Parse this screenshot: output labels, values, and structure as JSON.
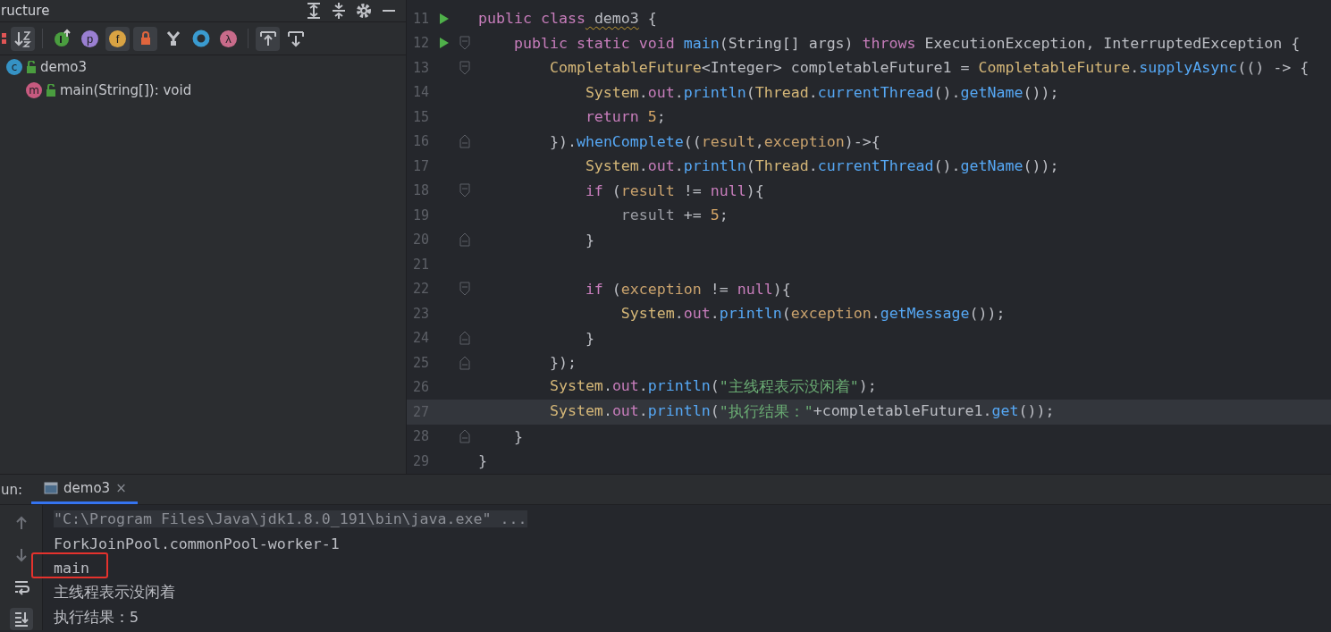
{
  "structure": {
    "title": "ructure",
    "toolbar": [
      {
        "kind": "sort-visibility",
        "selected": false
      },
      {
        "kind": "sort-alpha",
        "selected": true
      },
      {
        "kind": "inherited",
        "selected": false
      },
      {
        "kind": "letter",
        "glyph": "p",
        "color": "#9a7fd1",
        "selected": false
      },
      {
        "kind": "letter",
        "glyph": "f",
        "color": "#d9a343",
        "selected": true
      },
      {
        "kind": "lock",
        "selected": true
      },
      {
        "kind": "fork",
        "selected": false
      },
      {
        "kind": "ring",
        "selected": false
      },
      {
        "kind": "letter",
        "glyph": "λ",
        "color": "#c86b8a",
        "selected": false
      },
      {
        "kind": "autoscroll-to",
        "selected": true
      },
      {
        "kind": "autoscroll-from",
        "selected": false
      }
    ],
    "tree": [
      {
        "label": "demo3",
        "glyph": "c",
        "color": "#3592c4",
        "children": [
          {
            "label": "main(String[]): void",
            "glyph": "m",
            "color": "#c75a7f"
          }
        ]
      }
    ]
  },
  "editor": {
    "lines": [
      {
        "number": "11",
        "run": true,
        "fold_start": false,
        "fold_end": false,
        "current": false,
        "tokens": [
          {
            "text": "public class",
            "kind": "keyword"
          },
          {
            "text": " demo3",
            "kind": "warning"
          },
          {
            "text": " {",
            "kind": "plain"
          }
        ]
      },
      {
        "number": "12",
        "run": true,
        "fold_start": true,
        "fold_end": false,
        "current": false,
        "tokens": [
          {
            "text": "    public static void",
            "kind": "keyword"
          },
          {
            "text": " main",
            "kind": "method"
          },
          {
            "text": "(String[] args) ",
            "kind": "plain"
          },
          {
            "text": "throws",
            "kind": "keyword"
          },
          {
            "text": " ExecutionException, InterruptedException {",
            "kind": "plain"
          }
        ]
      },
      {
        "number": "13",
        "run": false,
        "fold_start": true,
        "fold_end": false,
        "current": false,
        "tokens": [
          {
            "text": "        CompletableFuture",
            "kind": "type"
          },
          {
            "text": "<Integer> completableFuture1 = ",
            "kind": "plain"
          },
          {
            "text": "CompletableFuture",
            "kind": "type"
          },
          {
            "text": ".",
            "kind": "plain"
          },
          {
            "text": "supplyAsync",
            "kind": "method"
          },
          {
            "text": "(() -> {",
            "kind": "plain"
          }
        ]
      },
      {
        "number": "14",
        "run": false,
        "fold_start": false,
        "fold_end": false,
        "current": false,
        "tokens": [
          {
            "text": "            System",
            "kind": "type"
          },
          {
            "text": ".",
            "kind": "plain"
          },
          {
            "text": "out",
            "kind": "field"
          },
          {
            "text": ".",
            "kind": "plain"
          },
          {
            "text": "println",
            "kind": "method"
          },
          {
            "text": "(",
            "kind": "plain"
          },
          {
            "text": "Thread",
            "kind": "type"
          },
          {
            "text": ".",
            "kind": "plain"
          },
          {
            "text": "currentThread",
            "kind": "method"
          },
          {
            "text": "().",
            "kind": "plain"
          },
          {
            "text": "getName",
            "kind": "method"
          },
          {
            "text": "());",
            "kind": "plain"
          }
        ]
      },
      {
        "number": "15",
        "run": false,
        "fold_start": false,
        "fold_end": false,
        "current": false,
        "tokens": [
          {
            "text": "            return",
            "kind": "keyword"
          },
          {
            "text": " 5",
            "kind": "number"
          },
          {
            "text": ";",
            "kind": "plain"
          }
        ]
      },
      {
        "number": "16",
        "run": false,
        "fold_start": false,
        "fold_end": true,
        "current": false,
        "tokens": [
          {
            "text": "        }).",
            "kind": "plain"
          },
          {
            "text": "whenComplete",
            "kind": "method"
          },
          {
            "text": "((",
            "kind": "plain"
          },
          {
            "text": "result",
            "kind": "param"
          },
          {
            "text": ",",
            "kind": "plain"
          },
          {
            "text": "exception",
            "kind": "param"
          },
          {
            "text": ")->{",
            "kind": "plain"
          }
        ]
      },
      {
        "number": "17",
        "run": false,
        "fold_start": false,
        "fold_end": false,
        "current": false,
        "tokens": [
          {
            "text": "            System",
            "kind": "type"
          },
          {
            "text": ".",
            "kind": "plain"
          },
          {
            "text": "out",
            "kind": "field"
          },
          {
            "text": ".",
            "kind": "plain"
          },
          {
            "text": "println",
            "kind": "method"
          },
          {
            "text": "(",
            "kind": "plain"
          },
          {
            "text": "Thread",
            "kind": "type"
          },
          {
            "text": ".",
            "kind": "plain"
          },
          {
            "text": "currentThread",
            "kind": "method"
          },
          {
            "text": "().",
            "kind": "plain"
          },
          {
            "text": "getName",
            "kind": "method"
          },
          {
            "text": "());",
            "kind": "plain"
          }
        ]
      },
      {
        "number": "18",
        "run": false,
        "fold_start": true,
        "fold_end": false,
        "current": false,
        "tokens": [
          {
            "text": "            if",
            "kind": "keyword"
          },
          {
            "text": " (",
            "kind": "plain"
          },
          {
            "text": "result",
            "kind": "param"
          },
          {
            "text": " != ",
            "kind": "plain"
          },
          {
            "text": "null",
            "kind": "keyword"
          },
          {
            "text": "){",
            "kind": "plain"
          }
        ]
      },
      {
        "number": "19",
        "run": false,
        "fold_start": false,
        "fold_end": false,
        "current": false,
        "tokens": [
          {
            "text": "                result",
            "kind": "dim"
          },
          {
            "text": " += ",
            "kind": "plain"
          },
          {
            "text": "5",
            "kind": "number"
          },
          {
            "text": ";",
            "kind": "plain"
          }
        ]
      },
      {
        "number": "20",
        "run": false,
        "fold_start": false,
        "fold_end": true,
        "current": false,
        "tokens": [
          {
            "text": "            }",
            "kind": "plain"
          }
        ]
      },
      {
        "number": "21",
        "run": false,
        "fold_start": false,
        "fold_end": false,
        "current": false
      },
      {
        "number": "22",
        "run": false,
        "fold_start": true,
        "fold_end": false,
        "current": false,
        "tokens": [
          {
            "text": "            if",
            "kind": "keyword"
          },
          {
            "text": " (",
            "kind": "plain"
          },
          {
            "text": "exception",
            "kind": "param"
          },
          {
            "text": " != ",
            "kind": "plain"
          },
          {
            "text": "null",
            "kind": "keyword"
          },
          {
            "text": "){",
            "kind": "plain"
          }
        ]
      },
      {
        "number": "23",
        "run": false,
        "fold_start": false,
        "fold_end": false,
        "current": false,
        "tokens": [
          {
            "text": "                System",
            "kind": "type"
          },
          {
            "text": ".",
            "kind": "plain"
          },
          {
            "text": "out",
            "kind": "field"
          },
          {
            "text": ".",
            "kind": "plain"
          },
          {
            "text": "println",
            "kind": "method"
          },
          {
            "text": "(",
            "kind": "plain"
          },
          {
            "text": "exception",
            "kind": "param"
          },
          {
            "text": ".",
            "kind": "plain"
          },
          {
            "text": "getMessage",
            "kind": "method"
          },
          {
            "text": "());",
            "kind": "plain"
          }
        ]
      },
      {
        "number": "24",
        "run": false,
        "fold_start": false,
        "fold_end": true,
        "current": false,
        "tokens": [
          {
            "text": "            }",
            "kind": "plain"
          }
        ]
      },
      {
        "number": "25",
        "run": false,
        "fold_start": false,
        "fold_end": true,
        "current": false,
        "tokens": [
          {
            "text": "        });",
            "kind": "plain"
          }
        ]
      },
      {
        "number": "26",
        "run": false,
        "fold_start": false,
        "fold_end": false,
        "current": false,
        "tokens": [
          {
            "text": "        System",
            "kind": "type"
          },
          {
            "text": ".",
            "kind": "plain"
          },
          {
            "text": "out",
            "kind": "field"
          },
          {
            "text": ".",
            "kind": "plain"
          },
          {
            "text": "println",
            "kind": "method"
          },
          {
            "text": "(",
            "kind": "plain"
          },
          {
            "text": "\"主线程表示没闲着\"",
            "kind": "string"
          },
          {
            "text": ");",
            "kind": "plain"
          }
        ]
      },
      {
        "number": "27",
        "run": false,
        "fold_start": false,
        "fold_end": false,
        "current": true,
        "tokens": [
          {
            "text": "        System",
            "kind": "type"
          },
          {
            "text": ".",
            "kind": "plain"
          },
          {
            "text": "out",
            "kind": "field"
          },
          {
            "text": ".",
            "kind": "plain"
          },
          {
            "text": "println",
            "kind": "method"
          },
          {
            "text": "(",
            "kind": "plain"
          },
          {
            "text": "\"执行结果：\"",
            "kind": "string"
          },
          {
            "text": "+completableFuture1.",
            "kind": "plain"
          },
          {
            "text": "get",
            "kind": "method"
          },
          {
            "text": "());",
            "kind": "plain"
          }
        ]
      },
      {
        "number": "28",
        "run": false,
        "fold_start": false,
        "fold_end": true,
        "current": false,
        "tokens": [
          {
            "text": "    }",
            "kind": "plain"
          }
        ]
      },
      {
        "number": "29",
        "run": false,
        "fold_start": false,
        "fold_end": false,
        "current": false,
        "tokens": [
          {
            "text": "}",
            "kind": "plain"
          }
        ]
      }
    ]
  },
  "run_panel": {
    "label": "un:",
    "tabs": [
      {
        "label": "demo3",
        "close": "×",
        "selected": true
      }
    ],
    "tools": [
      {
        "kind": "up"
      },
      {
        "kind": "down"
      },
      {
        "kind": "wrap"
      },
      {
        "kind": "scroll-end"
      }
    ],
    "output": [
      {
        "text": "\"C:\\Program Files\\Java\\jdk1.8.0_191\\bin\\java.exe\" ...",
        "kind": "command",
        "marked": false
      },
      {
        "text": "ForkJoinPool.commonPool-worker-1",
        "kind": "out",
        "marked": false
      },
      {
        "text": "main",
        "kind": "out",
        "marked": true
      },
      {
        "text": "主线程表示没闲着",
        "kind": "out",
        "marked": false
      },
      {
        "text": "执行结果：5",
        "kind": "out",
        "marked": false
      }
    ]
  }
}
